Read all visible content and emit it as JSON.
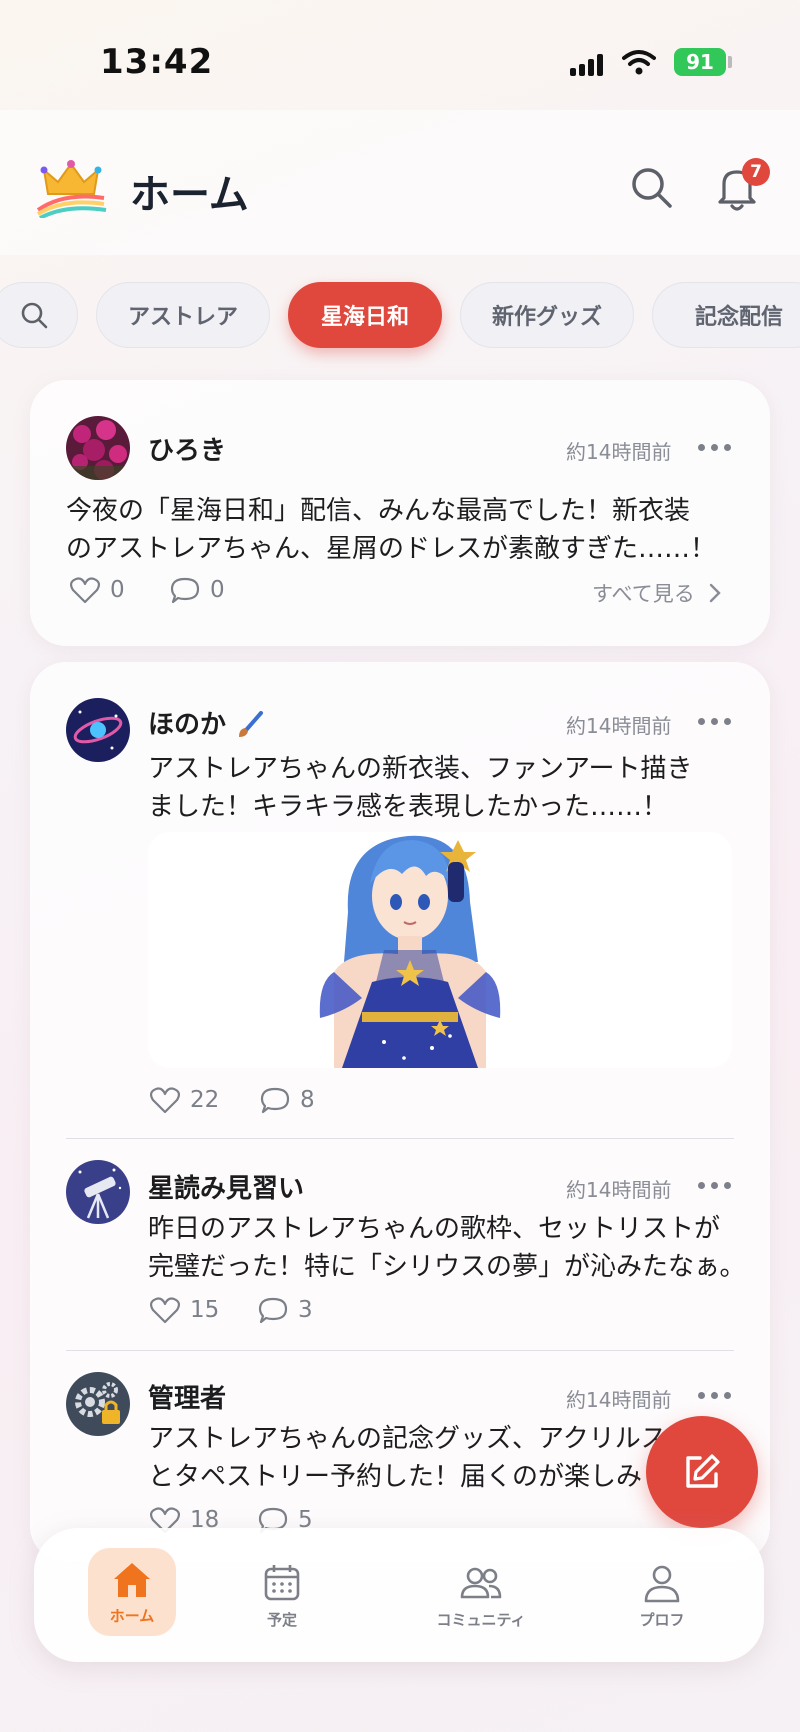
{
  "status_bar": {
    "time": "13:42",
    "battery": "91"
  },
  "header": {
    "title": "ホーム",
    "notification_count": "7"
  },
  "chips": [
    {
      "label": "アストレア",
      "active": false
    },
    {
      "label": "星海日和",
      "active": true
    },
    {
      "label": "新作グッズ",
      "active": false
    },
    {
      "label": "記念配信",
      "active": false
    }
  ],
  "posts": [
    {
      "user": "ひろき",
      "time": "約14時間前",
      "text_line1": "今夜の「星海日和」配信、みんな最高でした！新衣装",
      "text_line2": "のアストレアちゃん、星屑のドレスが素敵すぎた……！",
      "likes": "0",
      "comments": "0",
      "see_all": "すべて見る"
    },
    {
      "user": "ほのか",
      "user_emoji": "🖌",
      "time": "約14時間前",
      "text_line1": "アストレアちゃんの新衣装、ファンアート描き",
      "text_line2": "ました！キラキラ感を表現したかった……！",
      "likes": "22",
      "comments": "8"
    },
    {
      "user": "星読み見習い",
      "time": "約14時間前",
      "text_line1": "昨日のアストレアちゃんの歌枠、セットリストが",
      "text_line2": "完璧だった！特に「シリウスの夢」が沁みたなぁ。",
      "likes": "15",
      "comments": "3"
    },
    {
      "user": "管理者",
      "time": "約14時間前",
      "text_line1": "アストレアちゃんの記念グッズ、アクリルス",
      "text_line2": "とタペストリー予約した！届くのが楽しみ",
      "likes": "18",
      "comments": "5"
    }
  ],
  "bottom_nav": [
    {
      "label": "ホーム",
      "icon": "home-icon",
      "active": true
    },
    {
      "label": "予定",
      "icon": "calendar-icon",
      "active": false
    },
    {
      "label": "コミュニティ",
      "icon": "community-icon",
      "active": false
    },
    {
      "label": "プロフ",
      "icon": "profile-icon",
      "active": false
    }
  ],
  "colors": {
    "accent": "#e0483e",
    "nav_active": "#f0731e",
    "battery": "#32c759"
  }
}
